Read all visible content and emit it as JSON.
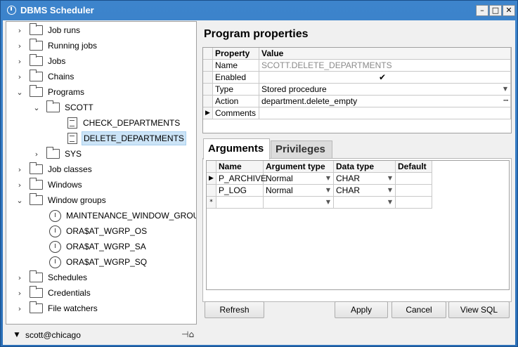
{
  "window": {
    "title": "DBMS Scheduler",
    "minimize_icon": "minimize-icon",
    "maximize_icon": "maximize-icon",
    "close_icon": "close-icon"
  },
  "tree": {
    "job_runs": "Job runs",
    "running_jobs": "Running jobs",
    "jobs": "Jobs",
    "chains": "Chains",
    "programs": "Programs",
    "scott": "SCOTT",
    "check_departments": "CHECK_DEPARTMENTS",
    "delete_departments": "DELETE_DEPARTMENTS",
    "sys": "SYS",
    "job_classes": "Job classes",
    "windows": "Windows",
    "window_groups": "Window groups",
    "maintenance_window_group": "MAINTENANCE_WINDOW_GROUP",
    "ora_wgrp_os": "ORA$AT_WGRP_OS",
    "ora_wgrp_sa": "ORA$AT_WGRP_SA",
    "ora_wgrp_sq": "ORA$AT_WGRP_SQ",
    "schedules": "Schedules",
    "credentials": "Credentials",
    "file_watchers": "File watchers"
  },
  "connection": {
    "label": "scott@chicago"
  },
  "program_properties": {
    "title": "Program properties",
    "col_property": "Property",
    "col_value": "Value",
    "rows": [
      {
        "property": "Name",
        "value": "SCOTT.DELETE_DEPARTMENTS"
      },
      {
        "property": "Enabled",
        "value": "✔"
      },
      {
        "property": "Type",
        "value": "Stored procedure"
      },
      {
        "property": "Action",
        "value": "department.delete_empty"
      },
      {
        "property": "Comments",
        "value": ""
      }
    ]
  },
  "tabs": {
    "arguments": "Arguments",
    "privileges": "Privileges"
  },
  "arguments": {
    "col_name": "Name",
    "col_type": "Argument type",
    "col_data_type": "Data type",
    "col_default": "Default",
    "rows": [
      {
        "name": "P_ARCHIVE",
        "type": "Normal",
        "data_type": "CHAR",
        "default": ""
      },
      {
        "name": "P_LOG",
        "type": "Normal",
        "data_type": "CHAR",
        "default": ""
      }
    ],
    "new_row_marker": "*"
  },
  "buttons": {
    "refresh": "Refresh",
    "apply": "Apply",
    "cancel": "Cancel",
    "view_sql": "View SQL"
  },
  "colors": {
    "title_bar": "#2a6fb8",
    "selection": "#cce4f7"
  }
}
